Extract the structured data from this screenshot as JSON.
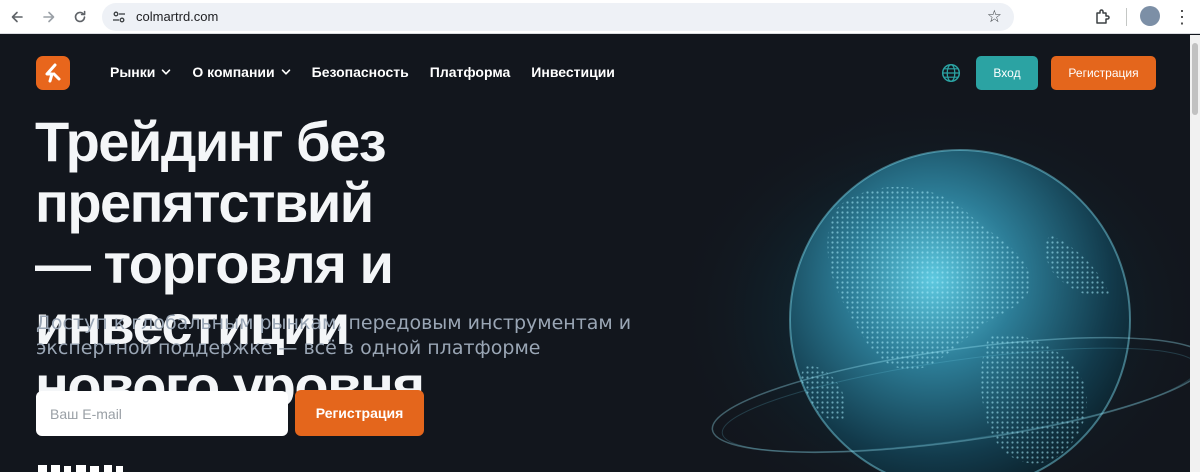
{
  "browser": {
    "url": "colmartrd.com"
  },
  "header": {
    "nav": [
      {
        "label": "Рынки",
        "dropdown": true
      },
      {
        "label": "О компании",
        "dropdown": true
      },
      {
        "label": "Безопасность",
        "dropdown": false
      },
      {
        "label": "Платформа",
        "dropdown": false
      },
      {
        "label": "Инвестиции",
        "dropdown": false
      }
    ],
    "login_label": "Вход",
    "register_label": "Регистрация"
  },
  "hero": {
    "title_line1": "Трейдинг без препятствий",
    "title_line2": "— торговля и инвестиции",
    "title_line3": "нового уровня",
    "subtitle_line1": "Доступ к глобальным рынкам, передовым инструментам и",
    "subtitle_line2": "экспертной поддержке — всё в одной платформе",
    "email_placeholder": "Ваш E-mail",
    "register_label": "Регистрация"
  },
  "colors": {
    "background": "#12161d",
    "accent_orange": "#e4661c",
    "accent_teal": "#2ba3a3"
  },
  "icons": [
    "back-arrow-icon",
    "forward-arrow-icon",
    "reload-icon",
    "site-info-icon",
    "bookmark-star-icon",
    "extensions-icon",
    "profile-avatar",
    "browser-menu-icon",
    "logo-icon",
    "chevron-down-icon",
    "language-globe-icon"
  ]
}
